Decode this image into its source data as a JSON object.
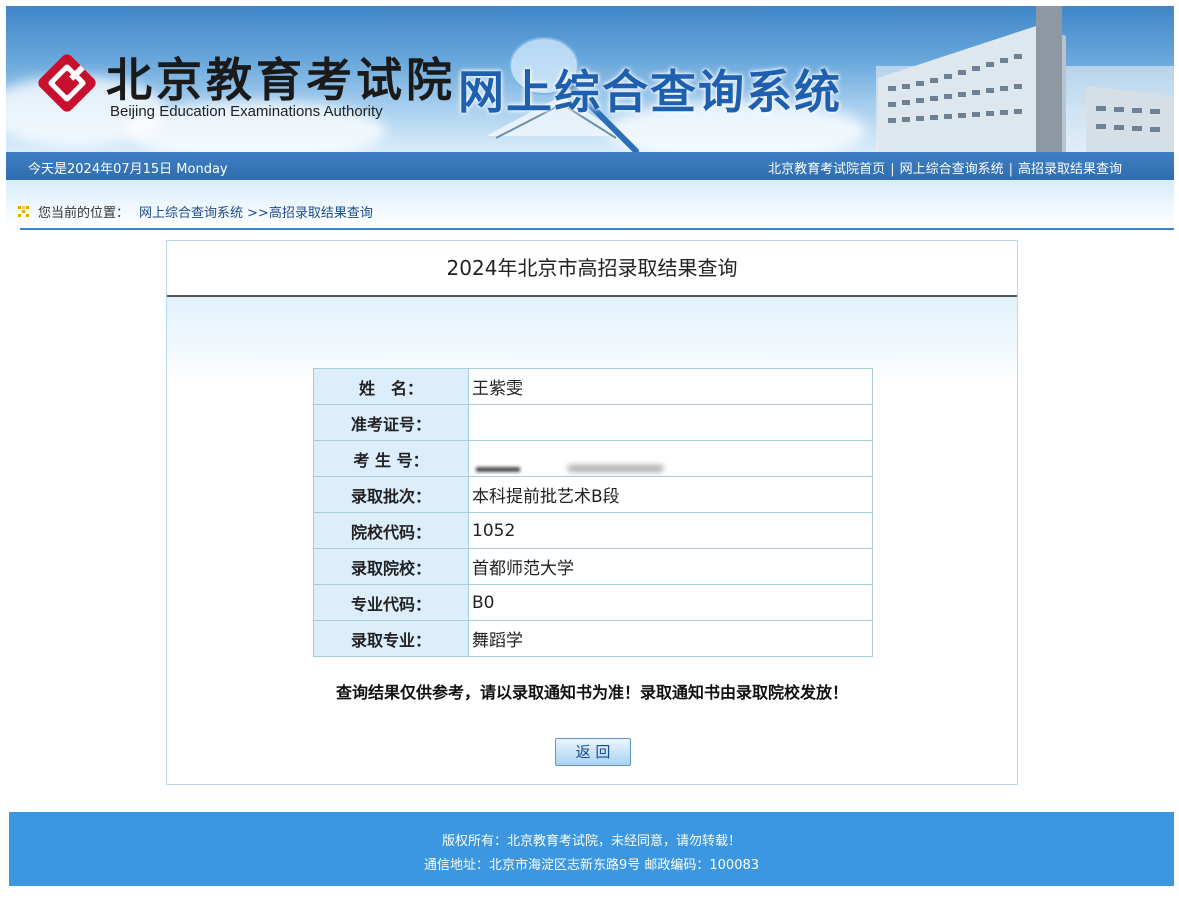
{
  "banner": {
    "logo_cn": "北京教育考试院",
    "logo_en": "Beijing Education Examinations Authority",
    "system_title": "网上综合查询系统"
  },
  "navbar": {
    "date": "今天是2024年07月15日 Monday",
    "links": [
      "北京教育考试院首页",
      "网上综合查询系统",
      "高招录取结果查询"
    ],
    "separator": "|"
  },
  "breadcrumb": {
    "prefix": "您当前的位置：",
    "system": "网上综合查询系统",
    "current": ">>高招录取结果查询"
  },
  "panel": {
    "title": "2024年北京市高招录取结果查询",
    "rows": [
      {
        "label": "姓　名：",
        "value": "王紫雯"
      },
      {
        "label": "准考证号：",
        "value": ""
      },
      {
        "label": "考 生 号：",
        "value": ""
      },
      {
        "label": "录取批次：",
        "value": "本科提前批艺术B段"
      },
      {
        "label": "院校代码：",
        "value": "1052"
      },
      {
        "label": "录取院校：",
        "value": "首都师范大学"
      },
      {
        "label": "专业代码：",
        "value": "B0"
      },
      {
        "label": "录取专业：",
        "value": "舞蹈学"
      }
    ],
    "notice": "查询结果仅供参考，请以录取通知书为准！录取通知书由录取院校发放！",
    "back_button": "返 回"
  },
  "footer": {
    "line1": "版权所有：北京教育考试院，未经同意，请勿转载！",
    "line2": "通信地址：北京市海淀区志新东路9号 邮政编码：100083"
  },
  "colors": {
    "nav_blue": "#2f6db0",
    "title_blue": "#1f5fb0",
    "footer_blue": "#3a97e0",
    "label_bg": "#dceefb",
    "logo_red": "#c8102e"
  },
  "icons": [
    "logo-mark-icon",
    "breadcrumb-dots-icon"
  ]
}
